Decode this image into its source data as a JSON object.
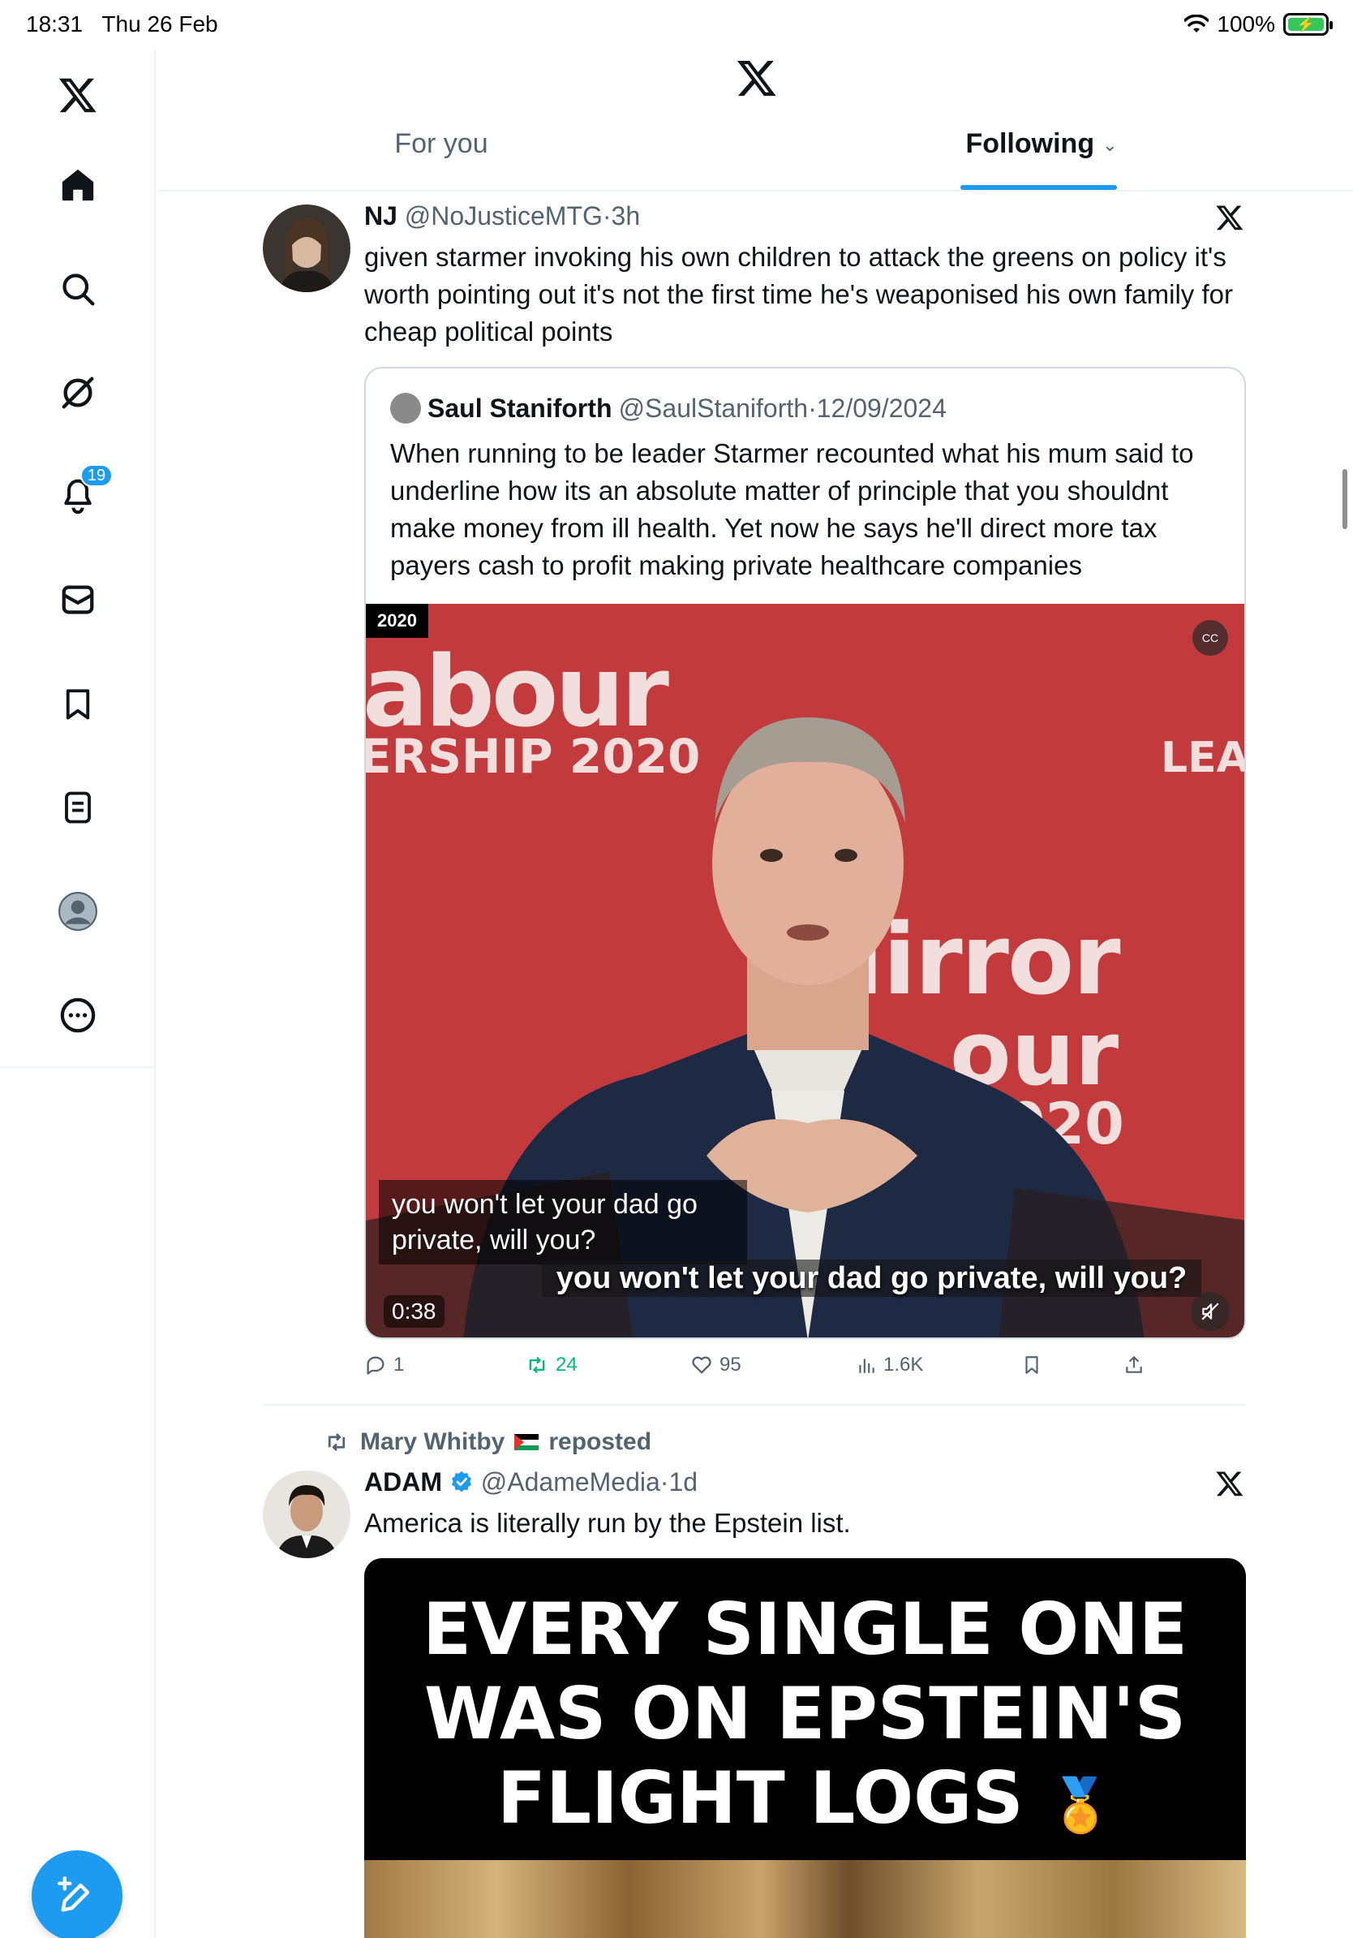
{
  "status_bar": {
    "time": "18:31",
    "date": "Thu 26 Feb",
    "battery": "100%"
  },
  "nav": {
    "notifications_badge": "19"
  },
  "header": {
    "tabs": [
      {
        "label": "For you"
      },
      {
        "label": "Following"
      }
    ]
  },
  "tweets": [
    {
      "name": "NJ",
      "handle": "@NoJusticeMTG",
      "sep": "·",
      "time": "3h",
      "text": "given starmer invoking his own children to attack the greens on policy it's worth pointing out it's not the first time he's weaponised his own family for cheap political points",
      "quote": {
        "name": "Saul Staniforth",
        "handle": "@SaulStaniforth",
        "sep": "·",
        "date": "12/09/2024",
        "text": "When running to be leader Starmer recounted what his mum said to underline how its an absolute matter of principle that you shouldnt make money from ill health. Yet now he says he'll direct more tax payers cash to profit making private healthcare companies",
        "video": {
          "tag": "2020",
          "cc_label": "CC",
          "subtitle_box": "you won't let your dad go private, will you?",
          "subtitle_burned": "you won't let your dad go private, will you?",
          "duration": "0:38",
          "bg_texts": {
            "top": "abour",
            "year": "ERSHIP 2020",
            "right": "LEAD",
            "mirror": "Mirror",
            "our": "our",
            "y2020": "2020"
          }
        }
      },
      "actions": {
        "replies": "1",
        "reposts": "24",
        "likes": "95",
        "views": "1.6K"
      }
    },
    {
      "repost_by": "Mary Whitby",
      "repost_suffix": "reposted",
      "name": "ADAM",
      "handle": "@AdameMedia",
      "sep": "·",
      "time": "1d",
      "text": "America is literally run by the Epstein list.",
      "media_text_lines": [
        "EVERY SINGLE ONE",
        "WAS ON EPSTEIN'S",
        "FLIGHT LOGS"
      ]
    }
  ],
  "colors": {
    "accent": "#1d9bf0",
    "repost_green": "#00ba7c",
    "secondary_text": "#536471"
  }
}
